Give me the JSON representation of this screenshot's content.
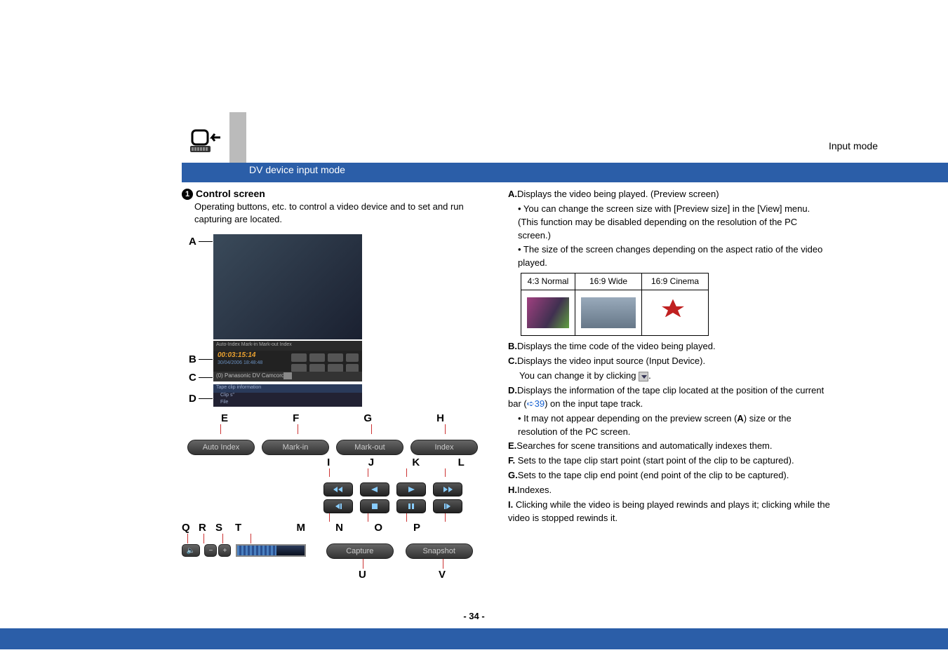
{
  "header": {
    "mode": "Input mode",
    "title": "DV device input mode"
  },
  "left": {
    "bullet": "1",
    "heading": "Control screen",
    "para": "Operating buttons, etc. to control a video device and to set and run capturing are located.",
    "fig": {
      "labels": {
        "A": "A",
        "B": "B",
        "C": "C",
        "D": "D",
        "E": "E",
        "F": "F",
        "G": "G",
        "H": "H",
        "I": "I",
        "J": "J",
        "K": "K",
        "L": "L",
        "M": "M",
        "N": "N",
        "O": "O",
        "P": "P",
        "Q": "Q",
        "R": "R",
        "S": "S",
        "T": "T",
        "U": "U",
        "V": "V"
      },
      "buttons": {
        "autoIndex": "Auto Index",
        "markIn": "Mark-in",
        "markOut": "Mark-out",
        "index": "Index",
        "capture": "Capture",
        "snapshot": "Snapshot"
      },
      "mini": {
        "tabs": "Auto-Index    Mark-in    Mark-out    Index",
        "timecode": "00:03:15:14",
        "date": "30/04/2006 18:48:48",
        "device": "(0) Panasonic DV Camcorder",
        "tape": "Tape clip information",
        "clip": "Clip s\"",
        "file": "File"
      }
    }
  },
  "right": {
    "A_line": "Displays the video being played. (Preview screen)",
    "A_sub1": "• You can change the screen size with [Preview size] in the [View] menu. (This function may be disabled depending on the resolution of the PC screen.)",
    "A_sub2": "• The size of the screen changes depending on the aspect ratio of the video played.",
    "table": {
      "h1": "4:3 Normal",
      "h2": "16:9 Wide",
      "h3": "16:9 Cinema"
    },
    "B": "Displays the time code of the video being played.",
    "C": "Displays the video input source (Input Device).",
    "C2a": "You can change it by clicking ",
    "C2b": ".",
    "D1": "Displays the information of the tape clip located at the position of the current bar (",
    "D_link": "➪39",
    "D2": ") on the input tape track.",
    "D_sub": "• It may not appear depending on the preview screen (",
    "D_subA": "A",
    "D_sub2": ") size or the resolution of the PC screen.",
    "E": "Searches for scene transitions and automatically indexes them.",
    "F": "Sets to the tape clip start point (start point of the clip to be captured).",
    "G": "Sets to the tape clip end point (end point of the clip to be captured).",
    "H": "Indexes.",
    "I": "Clicking while the video is being played rewinds and plays it; clicking while the video is stopped rewinds it."
  },
  "labels": {
    "A": "A.",
    "B": "B.",
    "C": "C.",
    "D": "D.",
    "E": "E.",
    "F": "F.",
    "G": "G.",
    "H": "H.",
    "I": "I."
  },
  "pageNum": "- 34 -"
}
